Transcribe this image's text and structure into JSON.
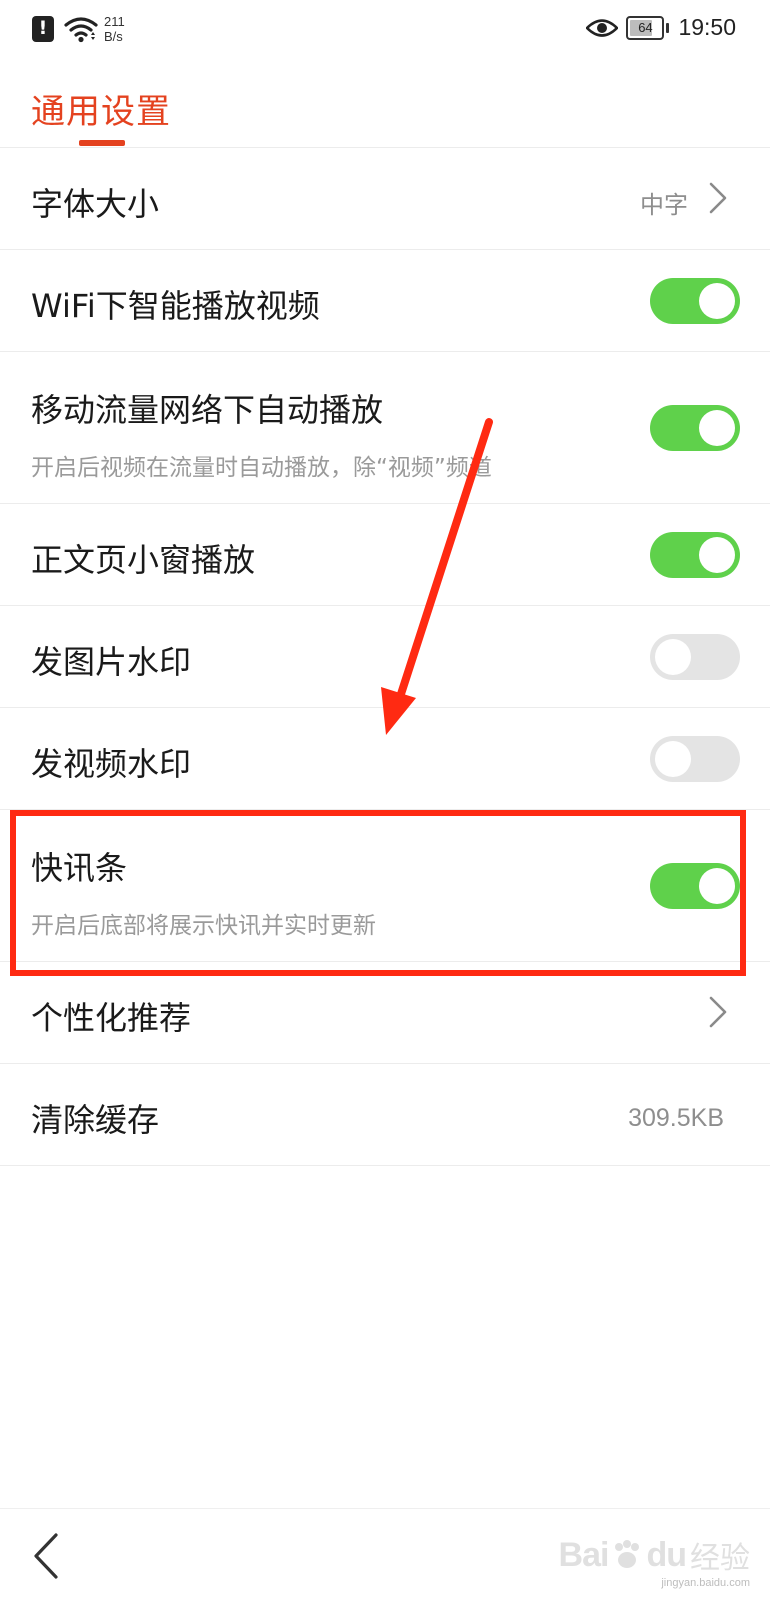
{
  "status_bar": {
    "net_speed_value": "211",
    "net_speed_unit": "B/s",
    "battery": "64",
    "time": "19:50"
  },
  "header": {
    "title": "通用设置",
    "accent_color": "#e4421f"
  },
  "settings": {
    "font_size": {
      "label": "字体大小",
      "value": "中字"
    },
    "wifi_autoplay": {
      "label": "WiFi下智能播放视频",
      "enabled": true
    },
    "mobile_autoplay": {
      "label": "移动流量网络下自动播放",
      "sub": "开启后视频在流量时自动播放，除“视频”频道",
      "enabled": true
    },
    "article_mini_player": {
      "label": "正文页小窗播放",
      "enabled": true
    },
    "image_watermark": {
      "label": "发图片水印",
      "enabled": false
    },
    "video_watermark": {
      "label": "发视频水印",
      "enabled": false
    },
    "news_flash_bar": {
      "label": "快讯条",
      "sub": "开启后底部将展示快讯并实时更新",
      "enabled": true
    },
    "personalized": {
      "label": "个性化推荐"
    },
    "clear_cache": {
      "label": "清除缓存",
      "value": "309.5KB"
    }
  },
  "colors": {
    "toggle_on": "#5fd14b",
    "toggle_off": "#e4e4e4",
    "annotation": "#ff2a12"
  },
  "icons": [
    "alert-icon",
    "wifi-icon",
    "eye-icon",
    "battery-icon",
    "chevron-right-icon",
    "back-chevron-icon"
  ],
  "watermark": {
    "brand": "Bai",
    "brand2": "du",
    "tag": "经验",
    "url": "jingyan.baidu.com"
  }
}
